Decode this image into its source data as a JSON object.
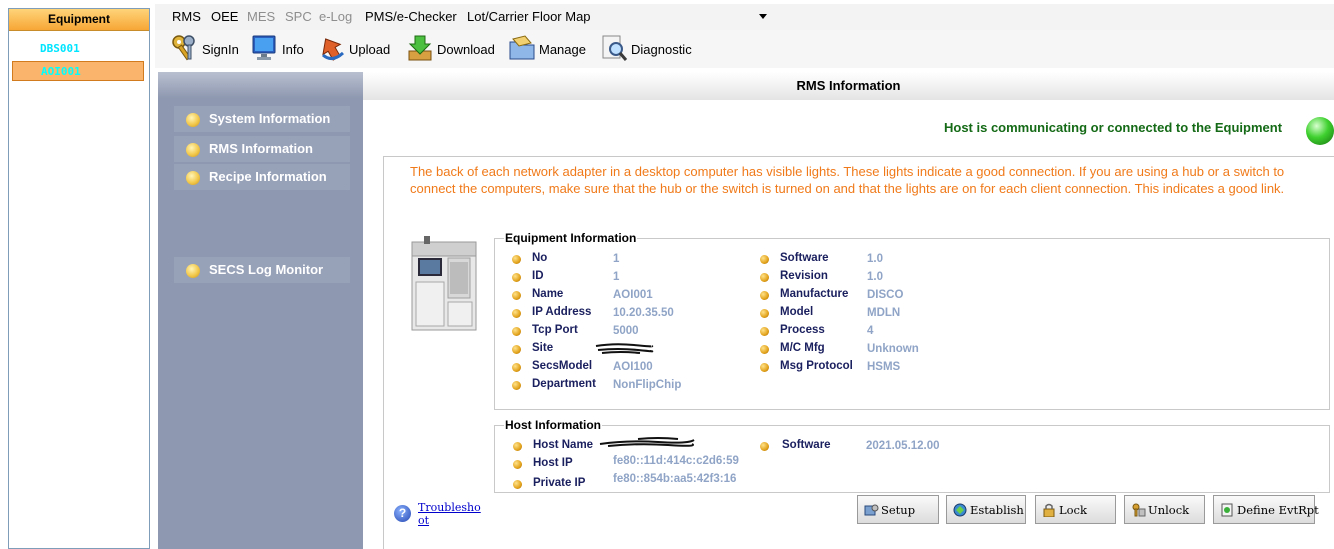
{
  "equipment_panel": {
    "header": "Equipment",
    "items": [
      {
        "label": "DBS001",
        "selected": false
      },
      {
        "label": "AOI001",
        "selected": true
      }
    ]
  },
  "menu": {
    "items": [
      {
        "label": "RMS",
        "enabled": true
      },
      {
        "label": "OEE",
        "enabled": true
      },
      {
        "label": "MES",
        "enabled": false
      },
      {
        "label": "SPC",
        "enabled": false
      },
      {
        "label": "e-Log",
        "enabled": false
      },
      {
        "label": "PMS/e-Checker",
        "enabled": true
      },
      {
        "label": "Lot/Carrier Floor Map",
        "enabled": true
      }
    ]
  },
  "toolbar": {
    "items": [
      {
        "label": "SignIn",
        "icon": "keys-icon"
      },
      {
        "label": "Info",
        "icon": "monitor-icon"
      },
      {
        "label": "Upload",
        "icon": "upload-arrow-icon"
      },
      {
        "label": "Download",
        "icon": "download-arrow-icon"
      },
      {
        "label": "Manage",
        "icon": "folder-manage-icon"
      },
      {
        "label": "Diagnostic",
        "icon": "magnifier-icon"
      }
    ]
  },
  "nav": {
    "items": [
      {
        "label": "System Information"
      },
      {
        "label": "RMS Information"
      },
      {
        "label": "Recipe Information"
      },
      {
        "label": "SECS Log Monitor"
      }
    ]
  },
  "main": {
    "title": "RMS Information",
    "status_text": "Host is communicating or connected to the Equipment",
    "status_color": "#22c314",
    "intro": "The back of each network adapter in a desktop computer has visible lights. These lights indicate a good connection. If you are using a hub or a switch to connect the computers, make sure that the hub or the switch is turned on and that the lights are on for each client connection. This indicates a good link."
  },
  "equipment_info": {
    "title": "Equipment Information",
    "left": [
      {
        "label": "No",
        "value": "1"
      },
      {
        "label": "ID",
        "value": "1"
      },
      {
        "label": "Name",
        "value": "AOI001"
      },
      {
        "label": "IP Address",
        "value": "10.20.35.50"
      },
      {
        "label": "Tcp Port",
        "value": "5000"
      },
      {
        "label": "Site",
        "value": ""
      },
      {
        "label": "SecsModel",
        "value": "AOI100"
      },
      {
        "label": "Department",
        "value": "NonFlipChip"
      }
    ],
    "right": [
      {
        "label": "Software",
        "value": "1.0"
      },
      {
        "label": "Revision",
        "value": "1.0"
      },
      {
        "label": "Manufacture",
        "value": "DISCO"
      },
      {
        "label": "Model",
        "value": "MDLN"
      },
      {
        "label": "Process",
        "value": "4"
      },
      {
        "label": "M/C Mfg",
        "value": "Unknown"
      },
      {
        "label": "Msg Protocol",
        "value": "HSMS"
      }
    ]
  },
  "host_info": {
    "title": "Host Information",
    "left": [
      {
        "label": "Host Name",
        "value": ""
      },
      {
        "label": "Host IP",
        "value": "fe80::11d:414c:c2d6:59"
      },
      {
        "label": "Private IP",
        "value": "fe80::854b:aa5:42f3:16"
      }
    ],
    "right": [
      {
        "label": "Software",
        "value": "2021.05.12.00"
      }
    ]
  },
  "troubleshoot_label": "Troubleshoot",
  "buttons": [
    {
      "label": "Setup",
      "icon": "setup-icon"
    },
    {
      "label": "Establish",
      "icon": "establish-icon"
    },
    {
      "label": "Lock",
      "icon": "lock-icon"
    },
    {
      "label": "Unlock",
      "icon": "unlock-icon"
    },
    {
      "label": "Define EvtRpt",
      "icon": "define-report-icon"
    }
  ]
}
